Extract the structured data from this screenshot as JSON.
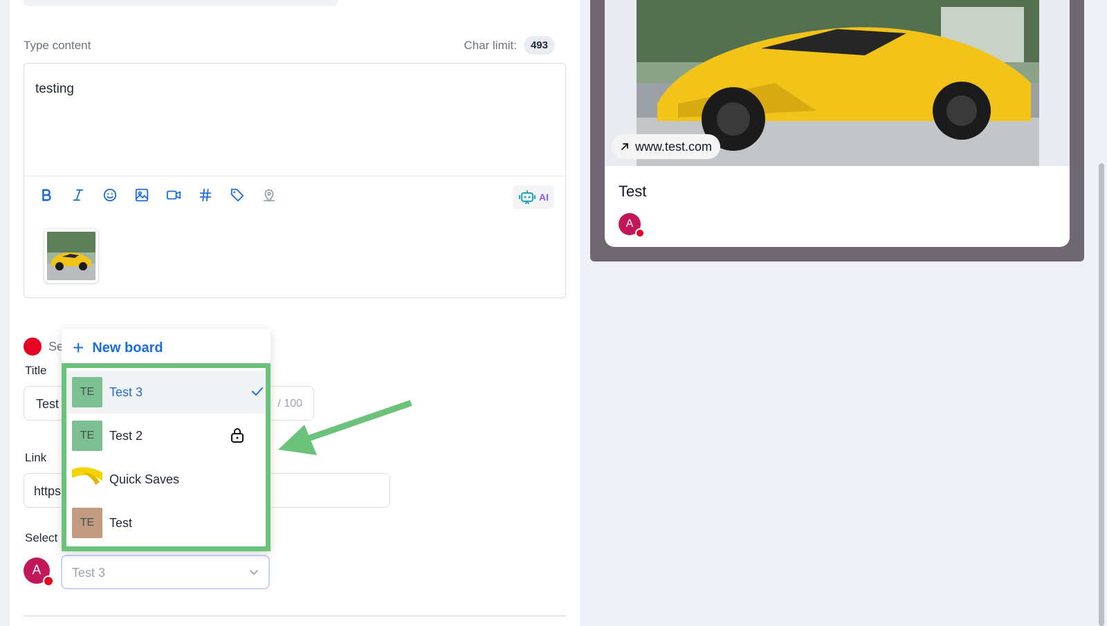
{
  "editor": {
    "content_label": "Type content",
    "char_limit_label": "Char limit:",
    "char_limit_value": "493",
    "text": "testing",
    "ai_label": "AI",
    "toolbar": [
      "bold-icon",
      "italic-icon",
      "emoji-icon",
      "image-icon",
      "video-icon",
      "hashtag-icon",
      "tag-icon",
      "location-icon"
    ]
  },
  "pinterest": {
    "section_label": "Se",
    "title_label": "Title",
    "title_value": "Test",
    "title_count": "/ 100",
    "link_label": "Link",
    "link_value": "https",
    "select_label": "Select",
    "avatar_initial": "A",
    "board_selected": "Test 3"
  },
  "dropdown": {
    "new_board_label": "New board",
    "boards": [
      {
        "name": "Test 3",
        "thumb": "TE",
        "thumb_color": "#7fbf94",
        "selected": true,
        "locked": false
      },
      {
        "name": "Test 2",
        "thumb": "TE",
        "thumb_color": "#7fbf94",
        "selected": false,
        "locked": true
      },
      {
        "name": "Quick Saves",
        "thumb": "",
        "thumb_color": "#f5d300",
        "selected": false,
        "locked": false
      },
      {
        "name": "Test",
        "thumb": "TE",
        "thumb_color": "#c19a80",
        "selected": false,
        "locked": false
      }
    ]
  },
  "preview": {
    "url": "www.test.com",
    "title": "Test",
    "avatar_initial": "A"
  },
  "colors": {
    "accent": "#1d6ddc",
    "highlight_green": "#6cc27b",
    "pinterest_red": "#e60023"
  }
}
